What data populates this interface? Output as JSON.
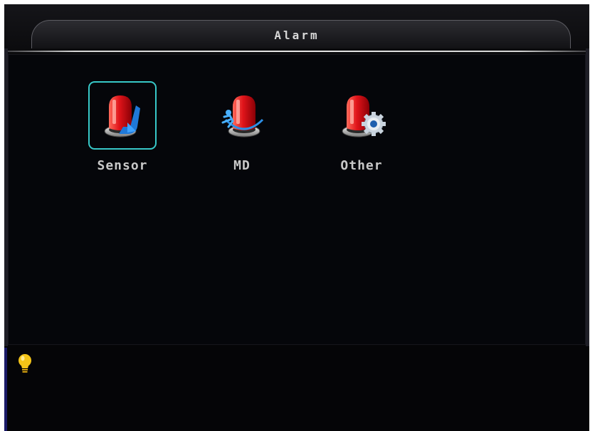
{
  "window": {
    "title": "Alarm"
  },
  "menu": {
    "items": [
      {
        "label": "Sensor",
        "icon": "alarm-sensor-icon",
        "selected": true
      },
      {
        "label": "MD",
        "icon": "alarm-motion-detection-icon",
        "selected": false
      },
      {
        "label": "Other",
        "icon": "alarm-other-settings-icon",
        "selected": false
      }
    ]
  },
  "hint": {
    "icon": "lightbulb-icon",
    "text": ""
  },
  "colors": {
    "background": "#060608",
    "selection_border": "#37c8c8",
    "label_text": "#c8c8c8",
    "alarm_red": "#e0141a",
    "bulb_yellow": "#f5c518"
  }
}
